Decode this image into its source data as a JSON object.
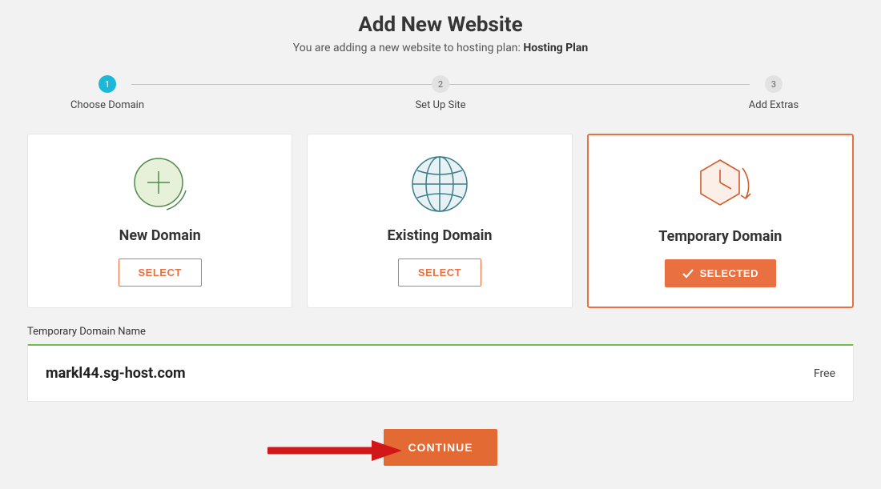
{
  "header": {
    "title": "Add New Website",
    "subtitle_prefix": "You are adding a new website to hosting plan: ",
    "plan_name": "Hosting Plan"
  },
  "steps": [
    {
      "num": "1",
      "label": "Choose Domain",
      "active": true
    },
    {
      "num": "2",
      "label": "Set Up Site",
      "active": false
    },
    {
      "num": "3",
      "label": "Add Extras",
      "active": false
    }
  ],
  "cards": {
    "new_domain": {
      "title": "New Domain",
      "button": "SELECT"
    },
    "existing_domain": {
      "title": "Existing Domain",
      "button": "SELECT"
    },
    "temporary_domain": {
      "title": "Temporary Domain",
      "button": "SELECTED"
    }
  },
  "temp_domain": {
    "section_label": "Temporary Domain Name",
    "value": "markl44.sg-host.com",
    "price": "Free"
  },
  "footer": {
    "continue": "CONTINUE"
  }
}
